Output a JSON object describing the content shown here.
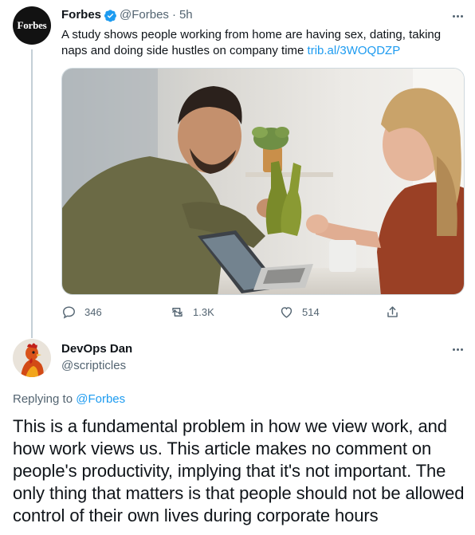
{
  "tweet1": {
    "display_name": "Forbes",
    "handle": "@Forbes",
    "separator": "·",
    "time": "5h",
    "avatar_text": "Forbes",
    "text": "A study shows people working from home are having sex, dating, taking naps and doing side hustles on company time ",
    "link": "trib.al/3WOQDZP",
    "stats": {
      "replies": "346",
      "retweets": "1.3K",
      "likes": "514"
    },
    "verified_color": "#1d9bf0"
  },
  "tweet2": {
    "display_name": "DevOps Dan",
    "handle": "@scripticles",
    "replying_prefix": "Replying to ",
    "replying_to": "@Forbes",
    "text": "This is a fundamental problem in how we view work, and how work views us. This article makes no comment on people's productivity, implying that it's not important. The only thing that matters is that people should not be allowed control of their own lives during corporate hours"
  },
  "colors": {
    "accent": "#1d9bf0",
    "muted": "#536471",
    "text": "#0f1419"
  }
}
